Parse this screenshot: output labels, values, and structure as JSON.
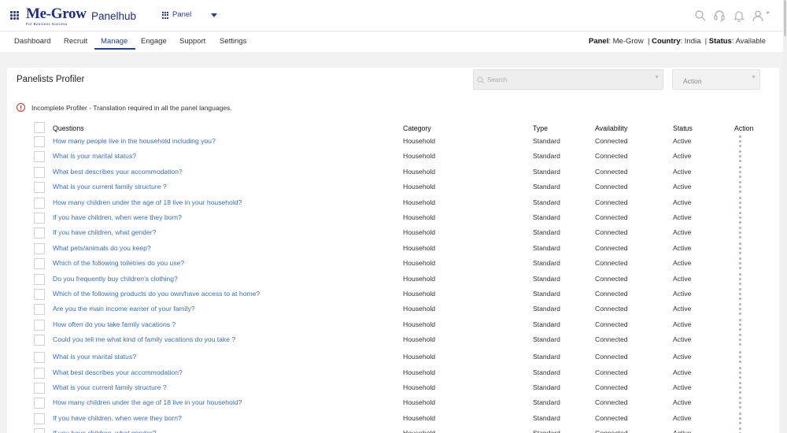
{
  "app": {
    "logo_text": "Me-Grow",
    "logo_tagline": "For Business Success",
    "name": "Panelhub",
    "panel_select": "Panel"
  },
  "nav": {
    "tabs": [
      "Dashboard",
      "Recruit",
      "Manage",
      "Engage",
      "Support",
      "Settings"
    ],
    "active": "Manage"
  },
  "panel_info": {
    "panel_label": "Panel",
    "panel_value": "Me-Grow",
    "country_label": "Country",
    "country_value": "India",
    "status_label": "Status",
    "status_value": "Available"
  },
  "page": {
    "title": "Panelists Profiler",
    "search_placeholder": "Search",
    "action_label": "Action",
    "warning": "Incomplete Profiler - Translation required in all the panel languages."
  },
  "table": {
    "headers": [
      "Questions",
      "Category",
      "Type",
      "Availability",
      "Status",
      "Action"
    ],
    "rows": [
      {
        "question": "How many people live in the household including you?",
        "category": "Household",
        "type": "Standard",
        "availability": "Connected",
        "status": "Active"
      },
      {
        "question": "What is your marital status?",
        "category": "Household",
        "type": "Standard",
        "availability": "Connected",
        "status": "Active"
      },
      {
        "question": "What best describes your accommodation?",
        "category": "Household",
        "type": "Standard",
        "availability": "Connected",
        "status": "Active"
      },
      {
        "question": "What is your current family structure ?",
        "category": "Household",
        "type": "Standard",
        "availability": "Connected",
        "status": "Active"
      },
      {
        "question": "How many children under the age of 18 live in your household?",
        "category": "Household",
        "type": "Standard",
        "availability": "Connected",
        "status": "Active"
      },
      {
        "question": "If you have children, when were they born?",
        "category": "Household",
        "type": "Standard",
        "availability": "Connected",
        "status": "Active"
      },
      {
        "question": "If you have children, what gender?",
        "category": "Household",
        "type": "Standard",
        "availability": "Connected",
        "status": "Active"
      },
      {
        "question": "What pets/animals do you keep?",
        "category": "Household",
        "type": "Standard",
        "availability": "Connected",
        "status": "Active"
      },
      {
        "question": "Which of the following toiletries do you use?",
        "category": "Household",
        "type": "Standard",
        "availability": "Connected",
        "status": "Active"
      },
      {
        "question": "Do you frequently buy children's clothing?",
        "category": "Household",
        "type": "Standard",
        "availability": "Connected",
        "status": "Active"
      },
      {
        "question": "Which of the following products do you own/have access to at home?",
        "category": "Household",
        "type": "Standard",
        "availability": "Connected",
        "status": "Active"
      },
      {
        "question": "Are you the main income earner of your family?",
        "category": "Household",
        "type": "Standard",
        "availability": "Connected",
        "status": "Active"
      },
      {
        "question": "How often do you take family vacations ?",
        "category": "Household",
        "type": "Standard",
        "availability": "Connected",
        "status": "Active"
      },
      {
        "question": "Could you tell me what kind of family vacations do you take ?",
        "category": "Household",
        "type": "Standard",
        "availability": "Connected",
        "status": "Active"
      },
      {
        "question": "What is your marital status?",
        "category": "Household",
        "type": "Standard",
        "availability": "Connected",
        "status": "Active"
      },
      {
        "question": "What best describes your accommodation?",
        "category": "Household",
        "type": "Standard",
        "availability": "Connected",
        "status": "Active"
      },
      {
        "question": "What is your current family structure ?",
        "category": "Household",
        "type": "Standard",
        "availability": "Connected",
        "status": "Active"
      },
      {
        "question": "How many children under the age of 18 live in your household?",
        "category": "Household",
        "type": "Standard",
        "availability": "Connected",
        "status": "Active"
      },
      {
        "question": "If you have children, when were they born?",
        "category": "Household",
        "type": "Standard",
        "availability": "Connected",
        "status": "Active"
      },
      {
        "question": "If you have children, what gender?",
        "category": "Household",
        "type": "Standard",
        "availability": "Connected",
        "status": "Active"
      }
    ]
  }
}
